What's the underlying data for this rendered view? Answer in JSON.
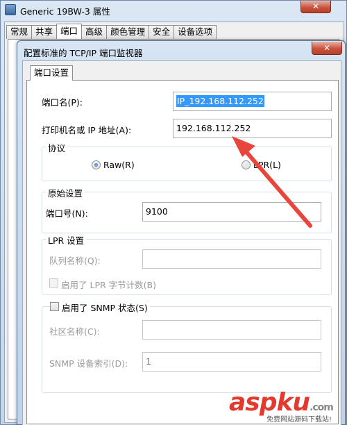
{
  "background_window": {
    "title": "Generic 19BW-3 属性",
    "close_label": "✕",
    "tabs": [
      "常规",
      "共享",
      "端口",
      "高级",
      "颜色管理",
      "安全",
      "设备选项"
    ],
    "active_tab": 2
  },
  "dialog": {
    "title": "配置标准的 TCP/IP 端口监视器",
    "close_label": "✕",
    "tab_label": "端口设置",
    "port_name": {
      "label": "端口名(P):",
      "value": "IP_192.168.112.252"
    },
    "printer_address": {
      "label": "打印机名或 IP 地址(A):",
      "value": "192.168.112.252"
    },
    "protocol": {
      "title": "协议",
      "raw_label": "Raw(R)",
      "lpr_label": "LPR(L)",
      "selected": "raw"
    },
    "raw_settings": {
      "title": "原始设置",
      "port_number_label": "端口号(N):",
      "port_number_value": "9100"
    },
    "lpr_settings": {
      "title": "LPR 设置",
      "queue_name_label": "队列名称(Q):",
      "queue_name_value": "",
      "byte_count_label": "启用了 LPR 字节计数(B)",
      "byte_count_checked": false
    },
    "snmp": {
      "enable_label": "启用了 SNMP 状态(S)",
      "enabled": false,
      "community_label": "社区名称(C):",
      "community_value": "",
      "device_index_label": "SNMP 设备索引(D):",
      "device_index_value": "1"
    }
  },
  "annotation": {
    "arrow_color": "#e8453c"
  },
  "watermark": {
    "logo_text": "aspku",
    "suffix_text": ".com",
    "subtitle": "免费网站源码下载站!"
  }
}
